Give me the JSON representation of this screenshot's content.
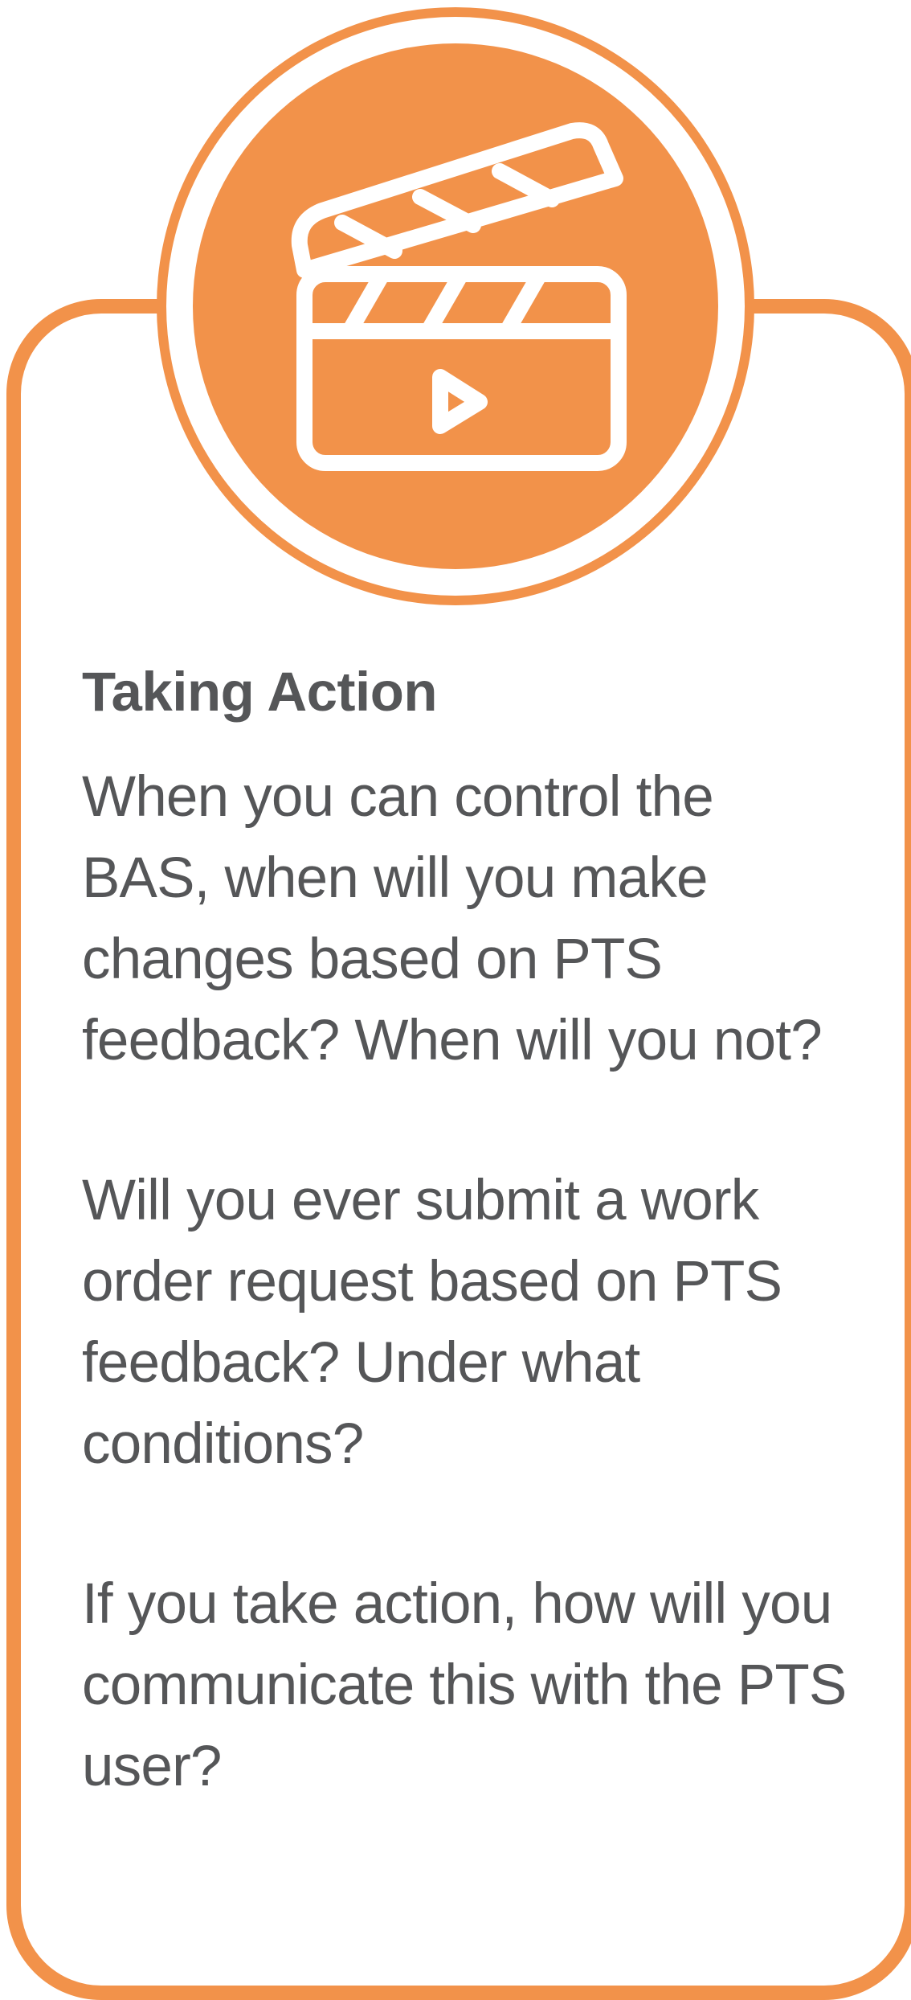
{
  "card": {
    "title": "Taking Action",
    "paragraphs": [
      "When you can control the BAS, when will you make changes based on PTS feedback? When will you not?",
      "Will you ever submit a work order request based on PTS feedback? Under what conditions?",
      "If you take action, how will you communicate this with the PTS user?"
    ]
  },
  "colors": {
    "accent": "#F2924A",
    "text": "#555658",
    "background": "#FFFFFF"
  },
  "icons": {
    "badge": "clapperboard-play-icon"
  }
}
